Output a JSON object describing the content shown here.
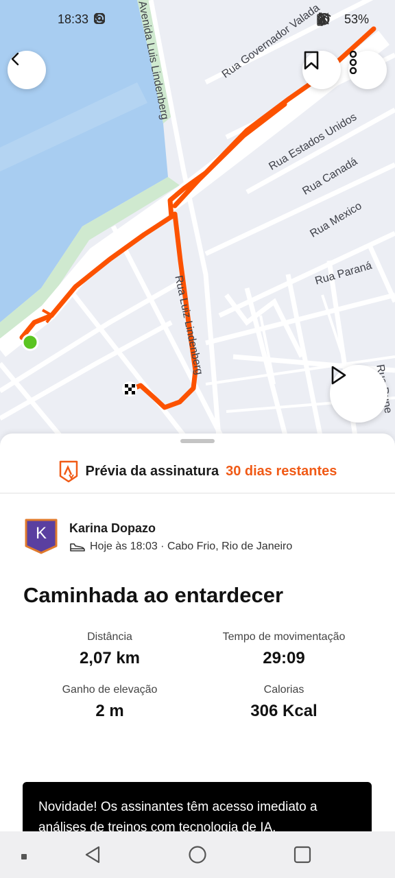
{
  "status_bar": {
    "time": "18:33",
    "left_icons": [
      "phone-alert-icon",
      "whatsapp-icon",
      "instagram-icon",
      "instagram-icon",
      "instagram-icon",
      "instagram-icon",
      "more-dots-icon"
    ],
    "right_icons": [
      "alarm-icon",
      "bluetooth-icon",
      "mute-icon",
      "wifi-icon",
      "signal-icon"
    ],
    "battery": "53%"
  },
  "map": {
    "streets": [
      "Avenida Luis Lindenberg",
      "Rua Governador Valada",
      "Rua Estados Unidos",
      "Rua Canadá",
      "Rua Mexico",
      "Rua Paraná",
      "Rua Luiz Lindenberg",
      "Rua Dune"
    ],
    "route_color": "#fc5200",
    "water_color": "#a8cdf1",
    "start_color": "#5ac421"
  },
  "promo": {
    "text": "Prévia da assinatura",
    "accent": "30 dias restantes"
  },
  "athlete": {
    "initial": "K",
    "name": "Karina Dopazo",
    "meta": "Hoje às 18:03 · Cabo Frio, Rio de Janeiro"
  },
  "activity": {
    "title": "Caminhada ao entardecer",
    "stats": [
      {
        "label": "Distância",
        "value": "2,07 km"
      },
      {
        "label": "Tempo de movimentação",
        "value": "29:09"
      },
      {
        "label": "Ganho de elevação",
        "value": "2 m"
      },
      {
        "label": "Calorias",
        "value": "306 Kcal"
      }
    ]
  },
  "banner": {
    "text": "Novidade! Os assinantes têm acesso imediato a análises de treinos com tecnologia de IA."
  }
}
